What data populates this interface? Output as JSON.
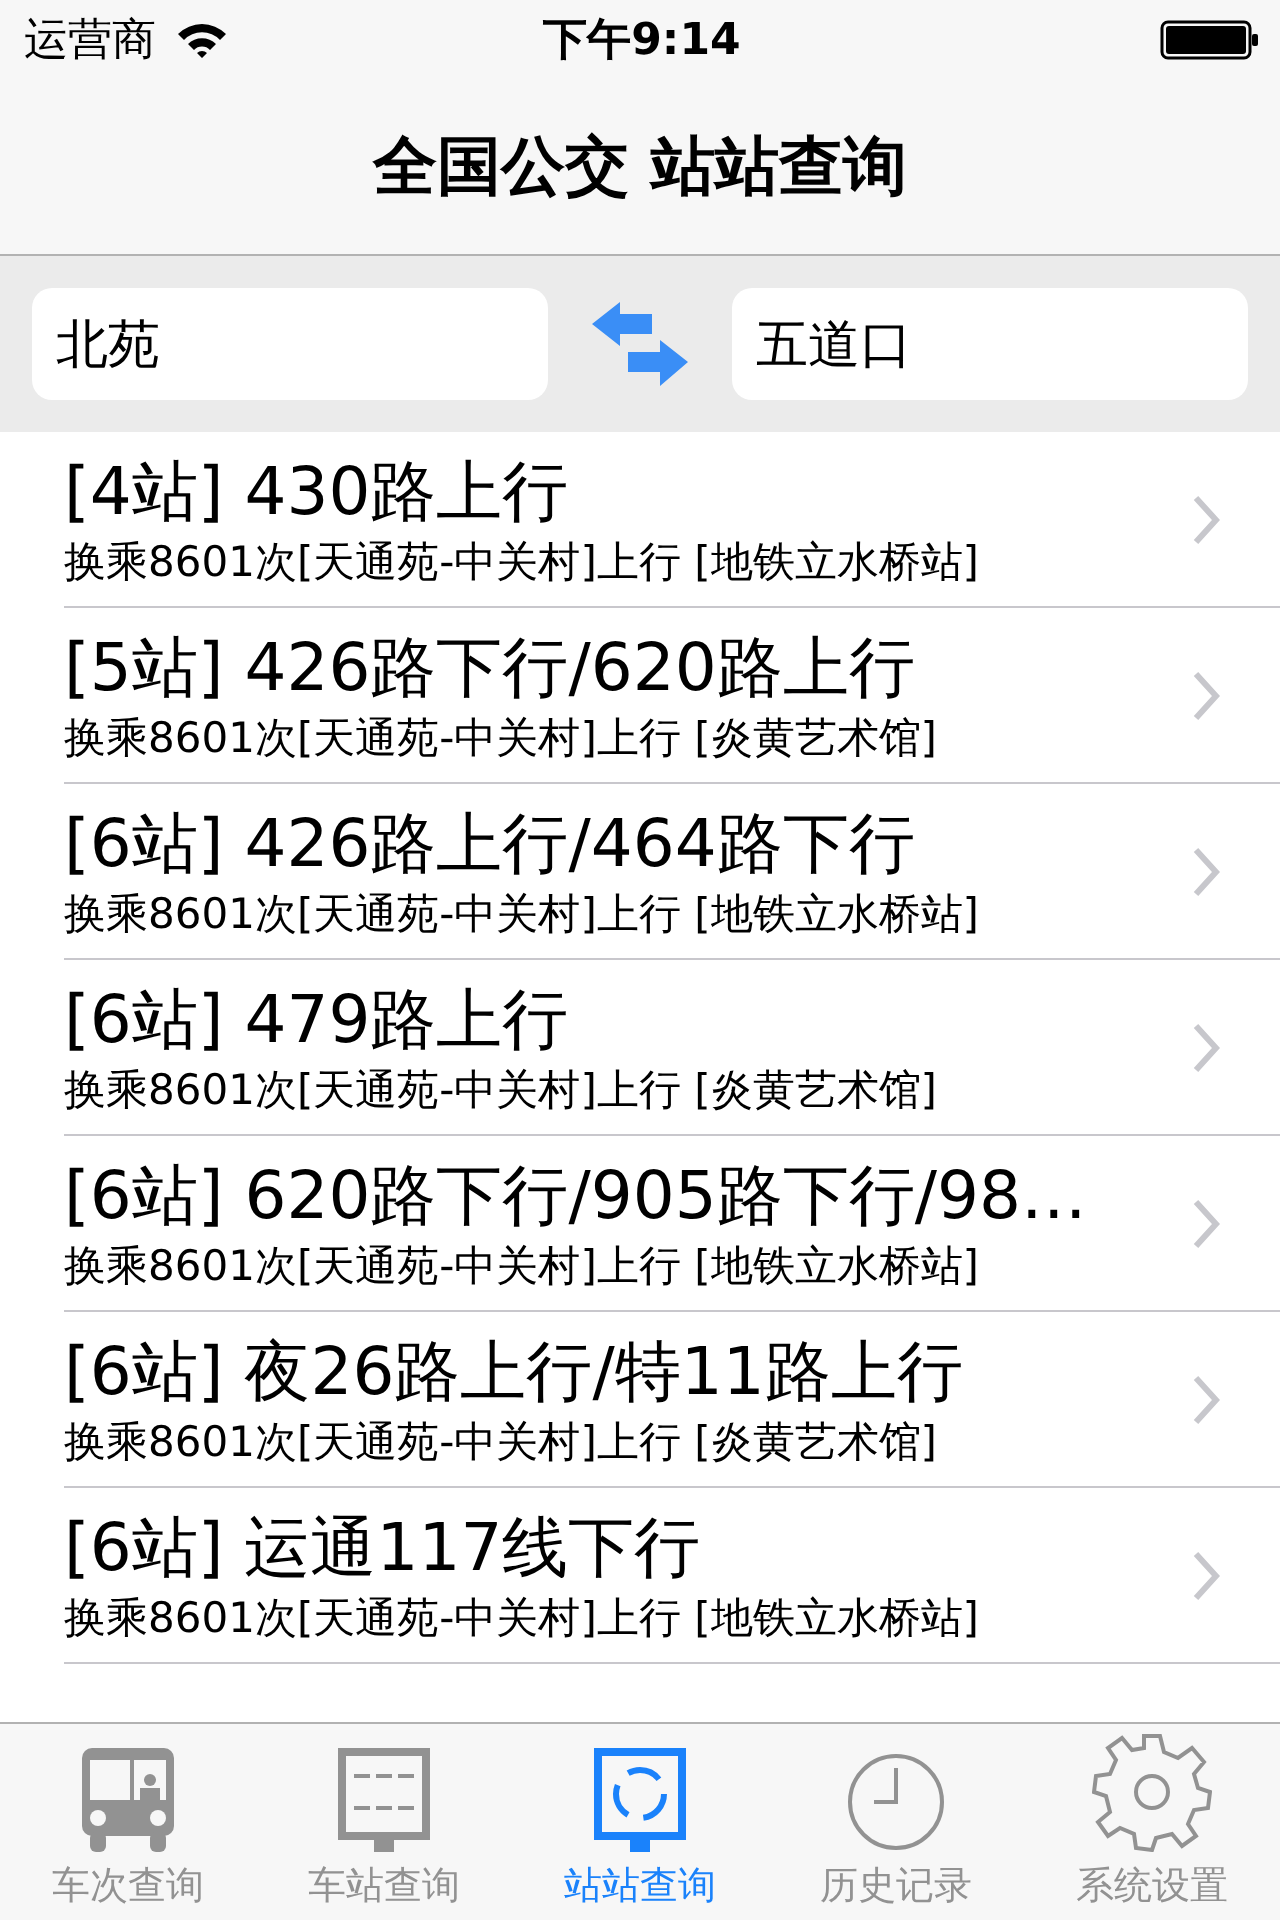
{
  "status_bar": {
    "carrier": "运营商",
    "time": "下午9:14"
  },
  "nav": {
    "title": "全国公交 站站查询"
  },
  "search": {
    "from": "北苑",
    "to": "五道口"
  },
  "routes": [
    {
      "title": "[4站] 430路上行",
      "detail": "换乘8601次[天通苑-中关村]上行 [地铁立水桥站]"
    },
    {
      "title": "[5站] 426路下行/620路上行",
      "detail": "换乘8601次[天通苑-中关村]上行 [炎黄艺术馆]"
    },
    {
      "title": "[6站] 426路上行/464路下行",
      "detail": "换乘8601次[天通苑-中关村]上行 [地铁立水桥站]"
    },
    {
      "title": "[6站] 479路上行",
      "detail": "换乘8601次[天通苑-中关村]上行 [炎黄艺术馆]"
    },
    {
      "title": "[6站] 620路下行/905路下行/98…",
      "detail": "换乘8601次[天通苑-中关村]上行 [地铁立水桥站]"
    },
    {
      "title": "[6站] 夜26路上行/特11路上行",
      "detail": "换乘8601次[天通苑-中关村]上行 [炎黄艺术馆]"
    },
    {
      "title": "[6站] 运通117线下行",
      "detail": "换乘8601次[天通苑-中关村]上行 [地铁立水桥站]"
    }
  ],
  "tabs": [
    {
      "kind": "bus",
      "label": "车次查询",
      "selected": false
    },
    {
      "kind": "board",
      "label": "车站查询",
      "selected": false
    },
    {
      "kind": "cycle",
      "label": "站站查询",
      "selected": true
    },
    {
      "kind": "clock",
      "label": "历史记录",
      "selected": false
    },
    {
      "kind": "gear",
      "label": "系统设置",
      "selected": false
    }
  ]
}
